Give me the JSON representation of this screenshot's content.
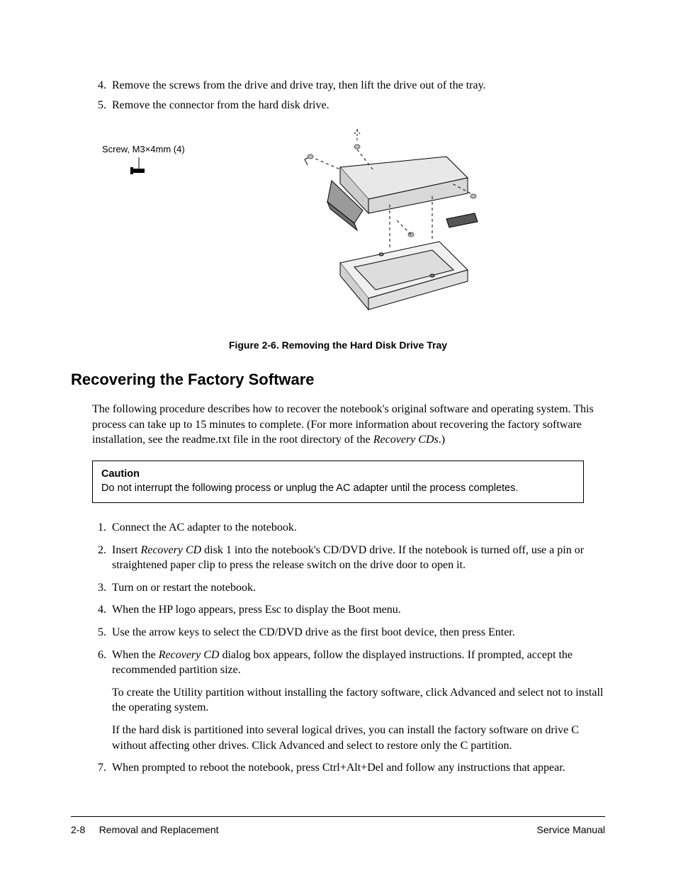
{
  "top_steps": [
    {
      "n": "4.",
      "text": "Remove the screws from the drive and drive tray, then lift the drive out of the tray."
    },
    {
      "n": "5.",
      "text": "Remove the connector from the hard disk drive."
    }
  ],
  "figure": {
    "screw_label": "Screw, M3×4mm (4)",
    "caption": "Figure 2-6. Removing the Hard Disk Drive Tray"
  },
  "section_title": "Recovering the Factory Software",
  "intro": {
    "pre": "The following procedure describes how to recover the notebook's original software and operating system. This process can take up to 15 minutes to complete. (For more information about recovering the factory software installation, see the readme.txt file in the root directory of the ",
    "em": "Recovery CDs",
    "post": ".)"
  },
  "caution": {
    "title": "Caution",
    "text": "Do not interrupt the following process or unplug the AC adapter until the process completes."
  },
  "steps": {
    "s1": {
      "n": "1.",
      "text": "Connect the AC adapter to the notebook."
    },
    "s2": {
      "n": "2.",
      "pre": "Insert ",
      "em": "Recovery CD",
      "post": " disk 1 into the notebook's CD/DVD drive. If the notebook is turned off, use a pin or straightened paper clip to press the release switch on the drive door to open it."
    },
    "s3": {
      "n": "3.",
      "text": "Turn on or restart the notebook."
    },
    "s4": {
      "n": "4.",
      "text": "When the HP logo appears, press Esc to display the Boot menu."
    },
    "s5": {
      "n": "5.",
      "text": "Use the arrow keys to select the CD/DVD drive as the first boot device, then press Enter."
    },
    "s6": {
      "n": "6.",
      "pre": "When the ",
      "em": "Recovery CD",
      "post": " dialog box appears, follow the displayed instructions. If prompted, accept the recommended partition size."
    },
    "s6a": "To create the Utility partition without installing the factory software, click Advanced and select not to install the operating system.",
    "s6b": "If the hard disk is partitioned into several logical drives, you can install the factory software on drive C without affecting other drives. Click Advanced and select to restore only the C partition.",
    "s7": {
      "n": "7.",
      "text": "When prompted to reboot the notebook, press Ctrl+Alt+Del and follow any instructions that appear."
    }
  },
  "footer": {
    "page": "2-8",
    "left": "Removal and Replacement",
    "right": "Service Manual"
  }
}
